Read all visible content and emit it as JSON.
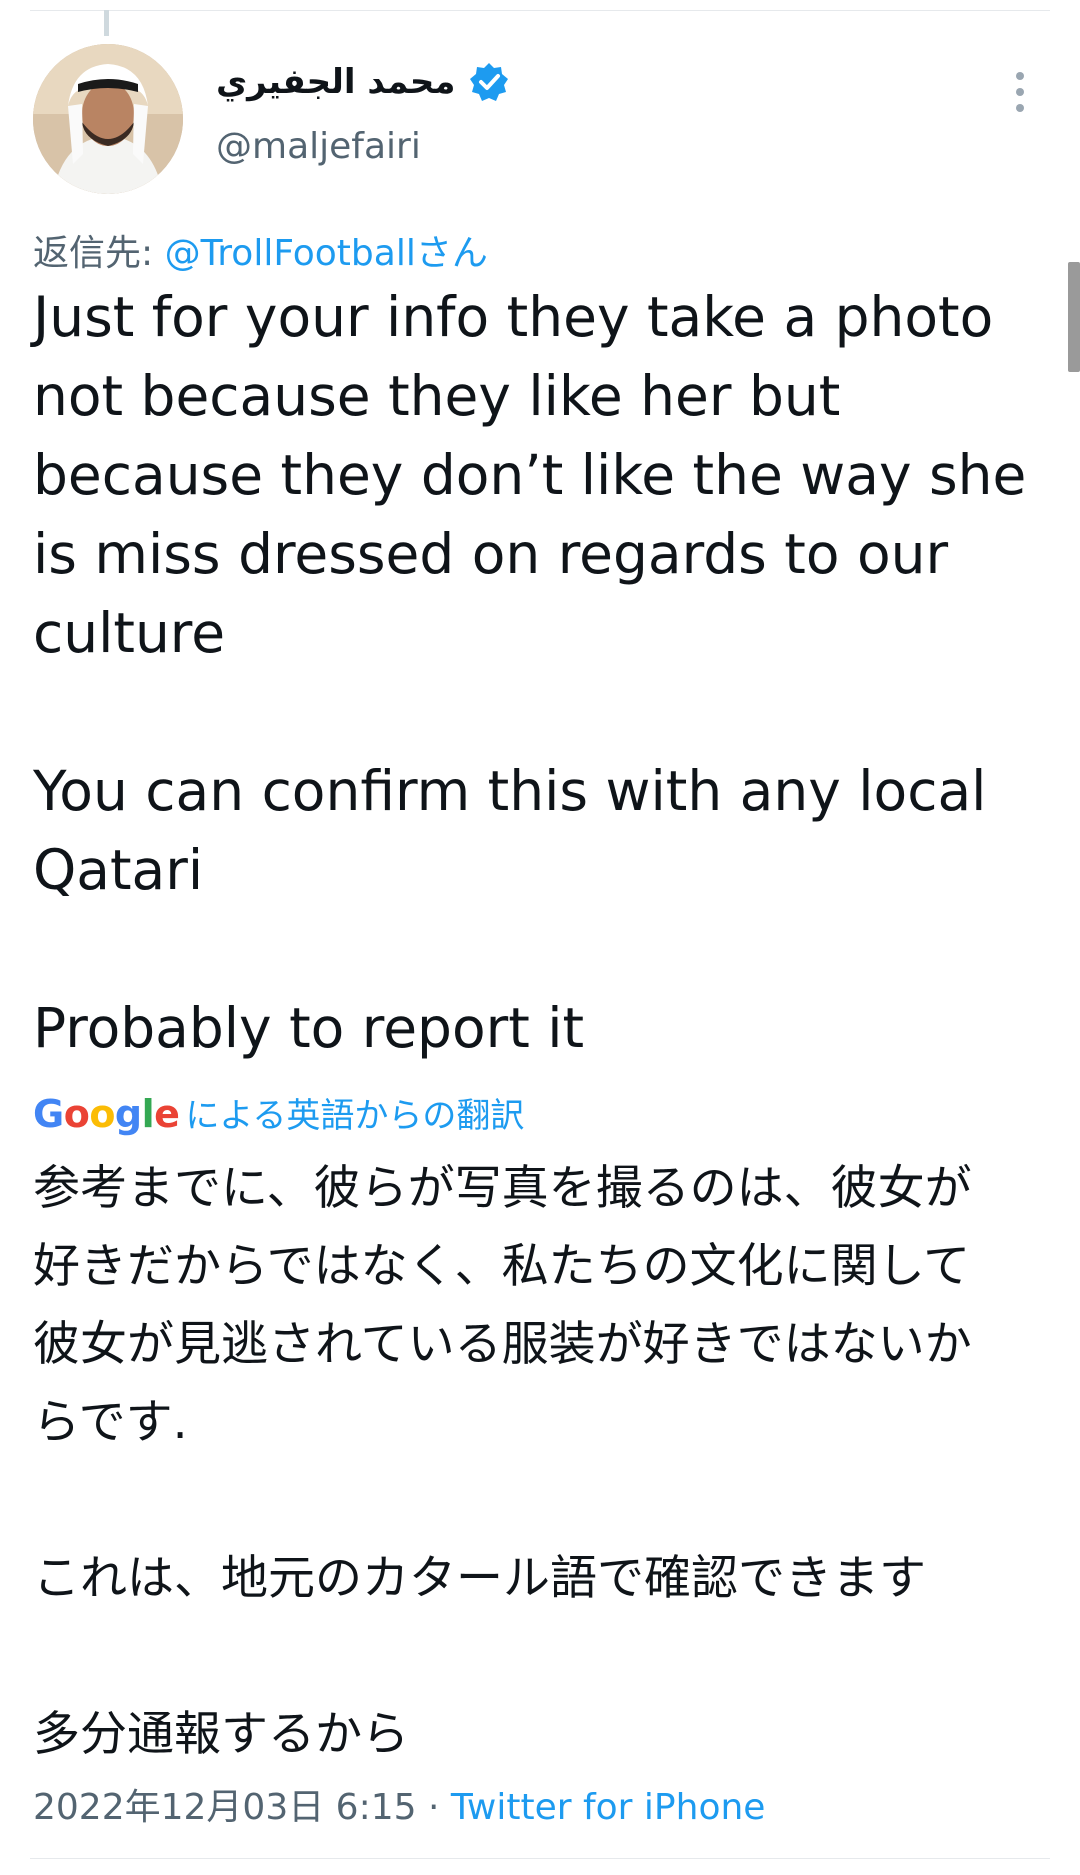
{
  "tweet": {
    "author": {
      "display_name": "محمد الجفيري",
      "handle": "@maljefairi",
      "avatar_icon": "user-avatar",
      "verified_icon": "verified-badge-icon"
    },
    "reply_to": {
      "prefix": "返信先: ",
      "mention": "@TrollFootballさん"
    },
    "text": "Just for your info they take a photo\nnot because they like her but\nbecause they don’t like the way she\nis miss dressed on regards to our\nculture\n\nYou can confirm this with any local\nQatari\n\nProbably to report it",
    "translation": {
      "provider": "Google",
      "label": "による英語からの翻訳",
      "text": "参考までに、彼らが写真を撮るのは、彼女が\n好きだからではなく、私たちの文化に関して\n彼女が見逃されている服装が好きではないか\nらです.\n\nこれは、地元のカタール語で確認できます\n\n多分通報するから"
    },
    "timestamp": "2022年12月03日 6:15",
    "separator": " · ",
    "source": "Twitter for iPhone"
  },
  "colors": {
    "accent": "#1d9bf0",
    "text_primary": "#0f1419",
    "text_secondary": "#536471"
  }
}
